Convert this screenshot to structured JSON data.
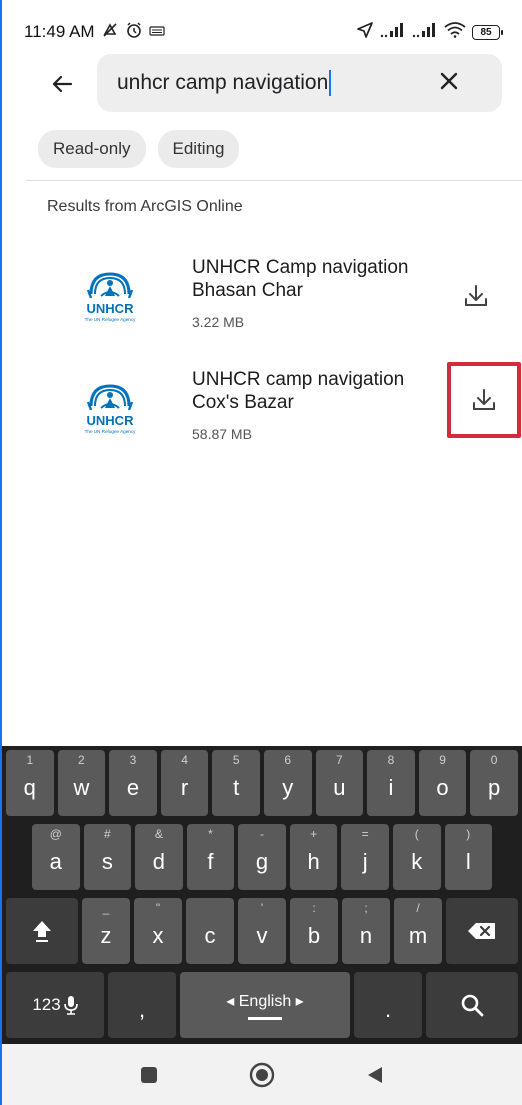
{
  "status": {
    "time": "11:49 AM",
    "battery": "85"
  },
  "search": {
    "query": "unhcr camp navigation"
  },
  "filters": [
    {
      "label": "Read-only"
    },
    {
      "label": "Editing"
    }
  ],
  "section_title": "Results from ArcGIS Online",
  "results": [
    {
      "title_line1": "UNHCR Camp navigation",
      "title_line2": "Bhasan Char",
      "size": "3.22 MB",
      "logo_text": "UNHCR",
      "logo_sub": "The UN Refugee Agency"
    },
    {
      "title_line1": "UNHCR camp navigation",
      "title_line2": "Cox's Bazar",
      "size": "58.87 MB",
      "logo_text": "UNHCR",
      "logo_sub": "The UN Refugee Agency"
    }
  ],
  "keyboard": {
    "row1": [
      {
        "k": "q",
        "h": "1"
      },
      {
        "k": "w",
        "h": "2"
      },
      {
        "k": "e",
        "h": "3"
      },
      {
        "k": "r",
        "h": "4"
      },
      {
        "k": "t",
        "h": "5"
      },
      {
        "k": "y",
        "h": "6"
      },
      {
        "k": "u",
        "h": "7"
      },
      {
        "k": "i",
        "h": "8"
      },
      {
        "k": "o",
        "h": "9"
      },
      {
        "k": "p",
        "h": "0"
      }
    ],
    "row2": [
      {
        "k": "a",
        "h": "@"
      },
      {
        "k": "s",
        "h": "#"
      },
      {
        "k": "d",
        "h": "&"
      },
      {
        "k": "f",
        "h": "*"
      },
      {
        "k": "g",
        "h": "-"
      },
      {
        "k": "h",
        "h": "+"
      },
      {
        "k": "j",
        "h": "="
      },
      {
        "k": "k",
        "h": "("
      },
      {
        "k": "l",
        "h": ")"
      }
    ],
    "row3": [
      {
        "k": "z",
        "h": "_"
      },
      {
        "k": "x",
        "h": "\""
      },
      {
        "k": "c",
        "h": ""
      },
      {
        "k": "v",
        "h": "'"
      },
      {
        "k": "b",
        "h": ":"
      },
      {
        "k": "n",
        "h": ";"
      },
      {
        "k": "m",
        "h": "/"
      }
    ],
    "numbers_label": "123",
    "comma": ",",
    "period": ".",
    "language": "English"
  },
  "colors": {
    "highlight": "#d22b3c",
    "unhcr_blue": "#0072bc",
    "caret": "#1a73e8"
  },
  "icons": {
    "back": "arrow-left-icon",
    "clear": "close-icon",
    "download": "download-icon",
    "search": "search-icon"
  }
}
